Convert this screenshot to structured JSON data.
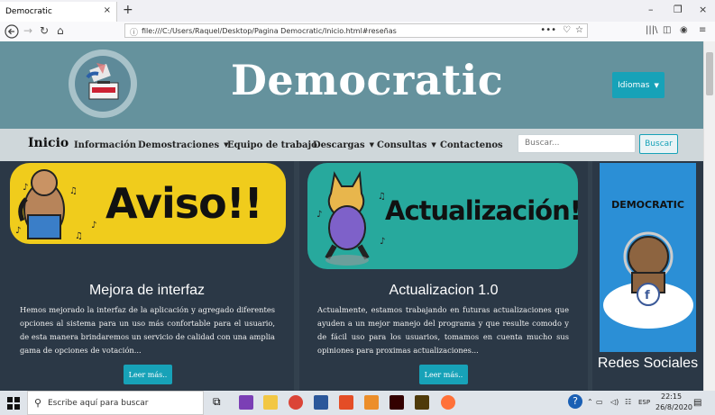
{
  "browser": {
    "tab_title": "Democratic",
    "tab_close": "×",
    "new_tab": "+",
    "url": "file:///C:/Users/Raquel/Desktop/Pagina Democratic/Inicio.html#reseñas",
    "url_more": "•••",
    "window_minimize": "–",
    "window_restore": "❐",
    "window_close": "×"
  },
  "hero": {
    "title": "Democratic",
    "language_button": "Idiomas"
  },
  "menu": {
    "home": "Inicio",
    "items": [
      {
        "label": "Información"
      },
      {
        "label": "Demostraciones"
      },
      {
        "label": "Equipo de trabajo"
      },
      {
        "label": "Descargas"
      },
      {
        "label": "Consultas"
      },
      {
        "label": "Contactenos"
      }
    ],
    "search_placeholder": "Buscar...",
    "search_button": "Buscar"
  },
  "cards": [
    {
      "banner": "Aviso!!",
      "banner_bg": "#f0cc1c",
      "title": "Mejora de interfaz",
      "text": "Hemos mejorado la interfaz de la aplicación y agregado diferentes opciones al sistema para un uso más confortable para el usuario, de esta manera brindaremos un servicio de calidad con una amplia gama de opciones de votación...",
      "button": "Leer más.."
    },
    {
      "banner": "Actualización!!",
      "banner_bg": "#27a99d",
      "title": "Actualizacion 1.0",
      "text": "Actualmente, estamos trabajando en futuras actualizaciones que ayuden a un mejor manejo del programa y que resulte comodo y de fácil uso para los usuarios, tomamos en cuenta mucho sus opiniones para proximas actualizaciones...",
      "button": "Leer más.."
    }
  ],
  "social": {
    "image_caption": "DEMOCRATIC",
    "title": "Redes Sociales"
  },
  "taskbar": {
    "search_placeholder": "Escribe aquí para buscar",
    "language": "ESP",
    "time": "22:15",
    "date": "26/8/2020"
  },
  "colors": {
    "hero_bg": "#65929d",
    "menu_bg": "#cfd7da",
    "page_bg": "#33414e",
    "accent": "#17a2b8"
  }
}
